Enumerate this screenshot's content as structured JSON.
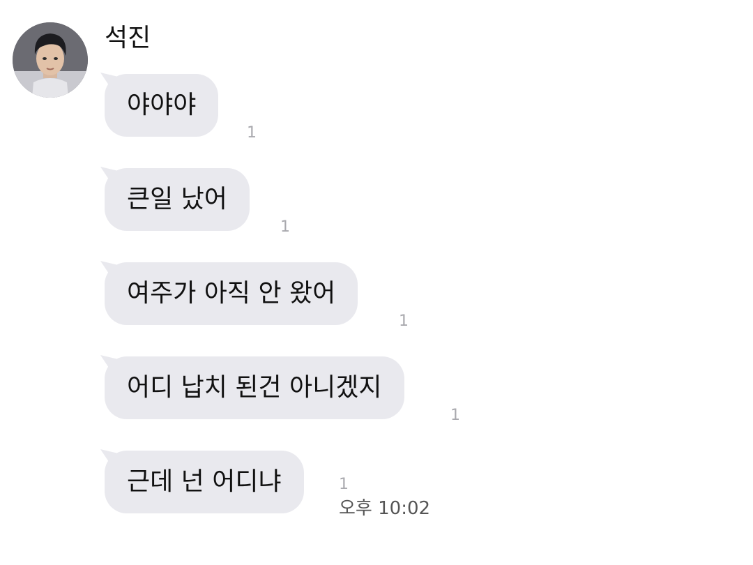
{
  "sender": {
    "name": "석진"
  },
  "messages": [
    {
      "text": "야야야",
      "unread": "1"
    },
    {
      "text": "큰일 났어",
      "unread": "1"
    },
    {
      "text": "여주가 아직 안 왔어",
      "unread": "1"
    },
    {
      "text": "어디 납치 된건 아니겠지",
      "unread": "1"
    },
    {
      "text": "근데 넌 어디냐",
      "unread": "1"
    }
  ],
  "last_message_time": "오후 10:02",
  "colors": {
    "bubble": "#e9e9ee",
    "unread_count": "#a9a9ae",
    "background": "#ffffff"
  }
}
